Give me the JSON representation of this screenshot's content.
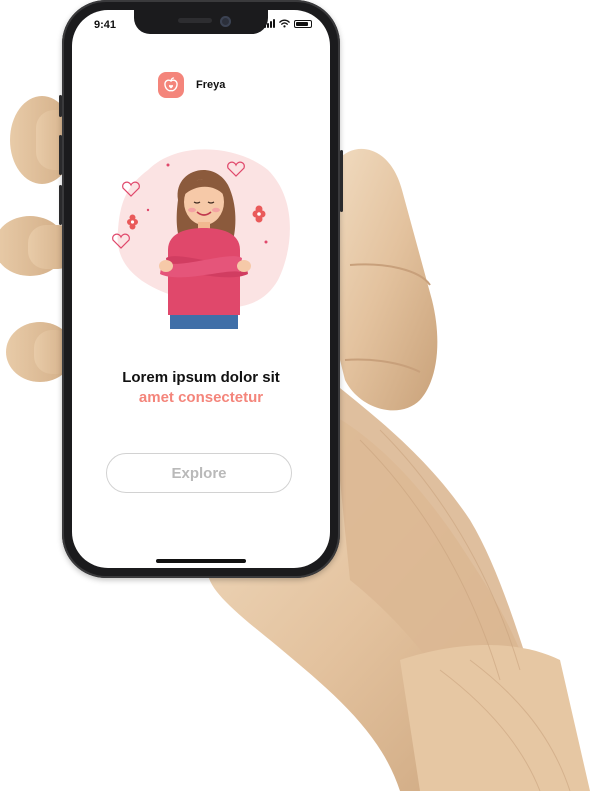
{
  "status_bar": {
    "time": "9:41"
  },
  "app": {
    "name": "Freya",
    "logo_icon": "apple-heart-icon"
  },
  "onboarding": {
    "headline_line1": "Lorem ipsum dolor sit",
    "headline_line2": "amet consectetur",
    "explore_label": "Explore",
    "illustration": "girl-self-hug-illustration"
  },
  "colors": {
    "accent": "#f4857b",
    "headline": "#111111",
    "button_text": "#b9b9b9",
    "button_border": "#d2d2d2",
    "sweater": "#e0486b",
    "blob": "#fbe3e3"
  }
}
